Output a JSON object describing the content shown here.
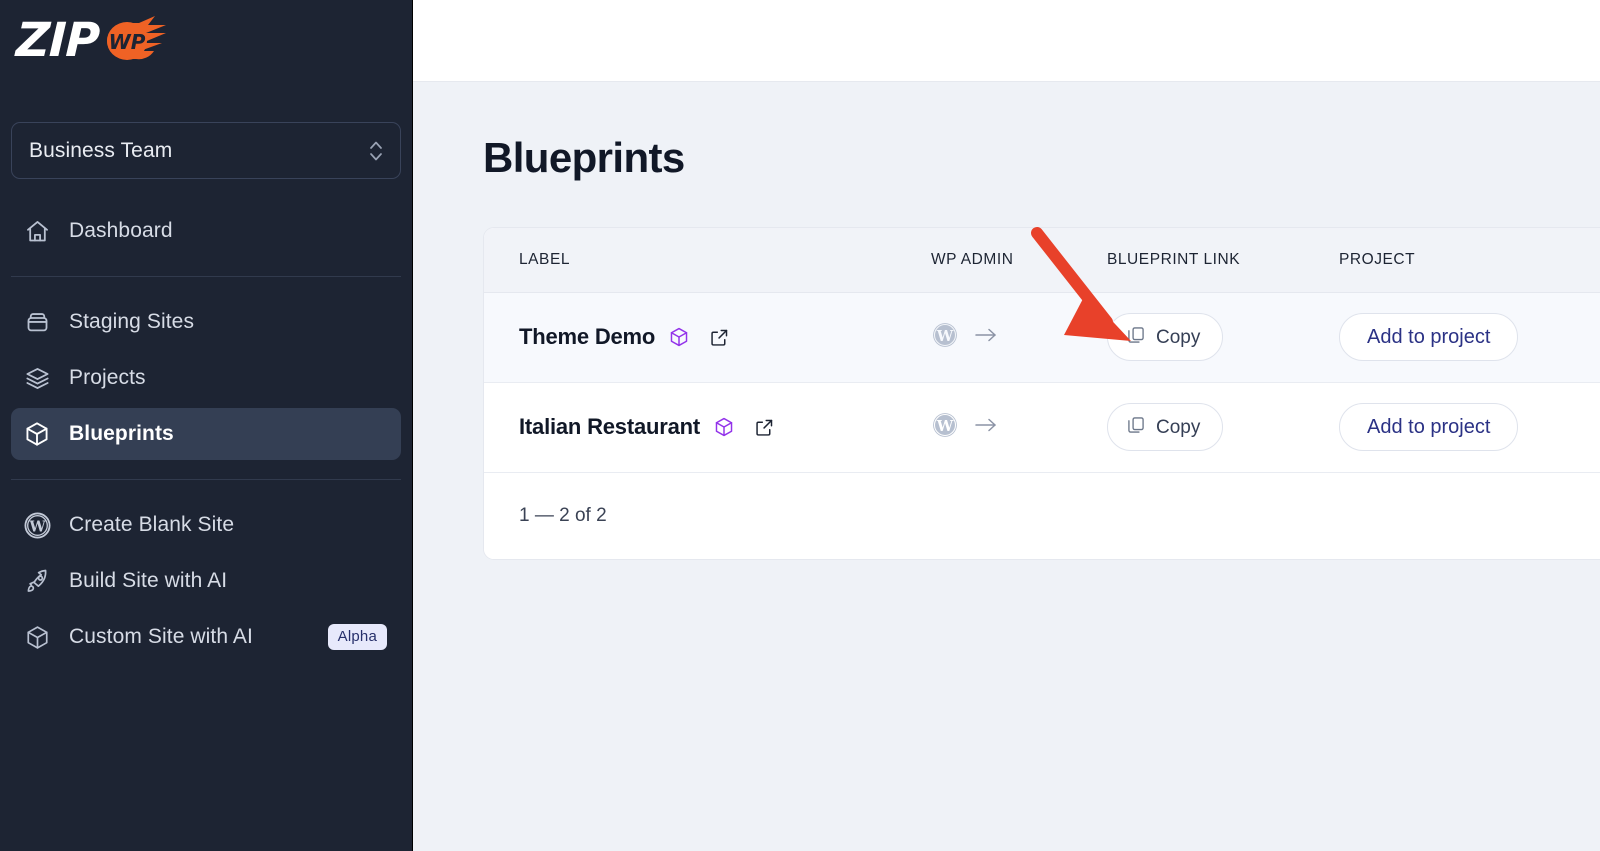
{
  "brand": {
    "logo_text": "ZIP",
    "logo_badge_text": "WP",
    "logo_color": "#ef6225",
    "sidebar_bg": "#1d2433"
  },
  "sidebar": {
    "team_selector": {
      "value": "Business Team",
      "icon": "chevron-up-down-icon"
    },
    "primary_items": [
      {
        "label": "Dashboard",
        "icon": "home-icon",
        "active": false
      }
    ],
    "secondary_items": [
      {
        "label": "Staging Sites",
        "icon": "archive-box-icon",
        "active": false
      },
      {
        "label": "Projects",
        "icon": "layers-icon",
        "active": false
      },
      {
        "label": "Blueprints",
        "icon": "cube-icon",
        "active": true
      }
    ],
    "tertiary_items": [
      {
        "label": "Create Blank Site",
        "icon": "wordpress-icon",
        "badge": "",
        "active": false
      },
      {
        "label": "Build Site with AI",
        "icon": "rocket-icon",
        "badge": "",
        "active": false
      },
      {
        "label": "Custom Site with AI",
        "icon": "cube-icon",
        "badge": "Alpha",
        "active": false
      }
    ]
  },
  "main": {
    "page_title": "Blueprints",
    "table": {
      "columns": [
        "LABEL",
        "WP ADMIN",
        "BLUEPRINT LINK",
        "PROJECT"
      ],
      "rows": [
        {
          "label": "Theme Demo",
          "label_icon": "cube-icon",
          "open_icon": "external-link-icon",
          "wp_admin_icon": "wordpress-icon",
          "wp_admin_arrow": "arrow-right-icon",
          "blueprint_link_label": "Copy",
          "blueprint_link_icon": "copy-icon",
          "project_action": "Add to project",
          "highlighted": true
        },
        {
          "label": "Italian Restaurant",
          "label_icon": "cube-icon",
          "open_icon": "external-link-icon",
          "wp_admin_icon": "wordpress-icon",
          "wp_admin_arrow": "arrow-right-icon",
          "blueprint_link_label": "Copy",
          "blueprint_link_icon": "copy-icon",
          "project_action": "Add to project",
          "highlighted": false
        }
      ],
      "pagination": "1 — 2 of 2"
    }
  },
  "annotation": {
    "type": "arrow",
    "color": "#e8412a",
    "points_to": "Copy button of row Theme Demo"
  },
  "colors": {
    "accent_orange": "#ef6225",
    "cube_purple": "#9333ea",
    "row_highlight": "#f7f9fd",
    "page_bg": "#eff2f7",
    "annotation_red": "#e8412a"
  }
}
